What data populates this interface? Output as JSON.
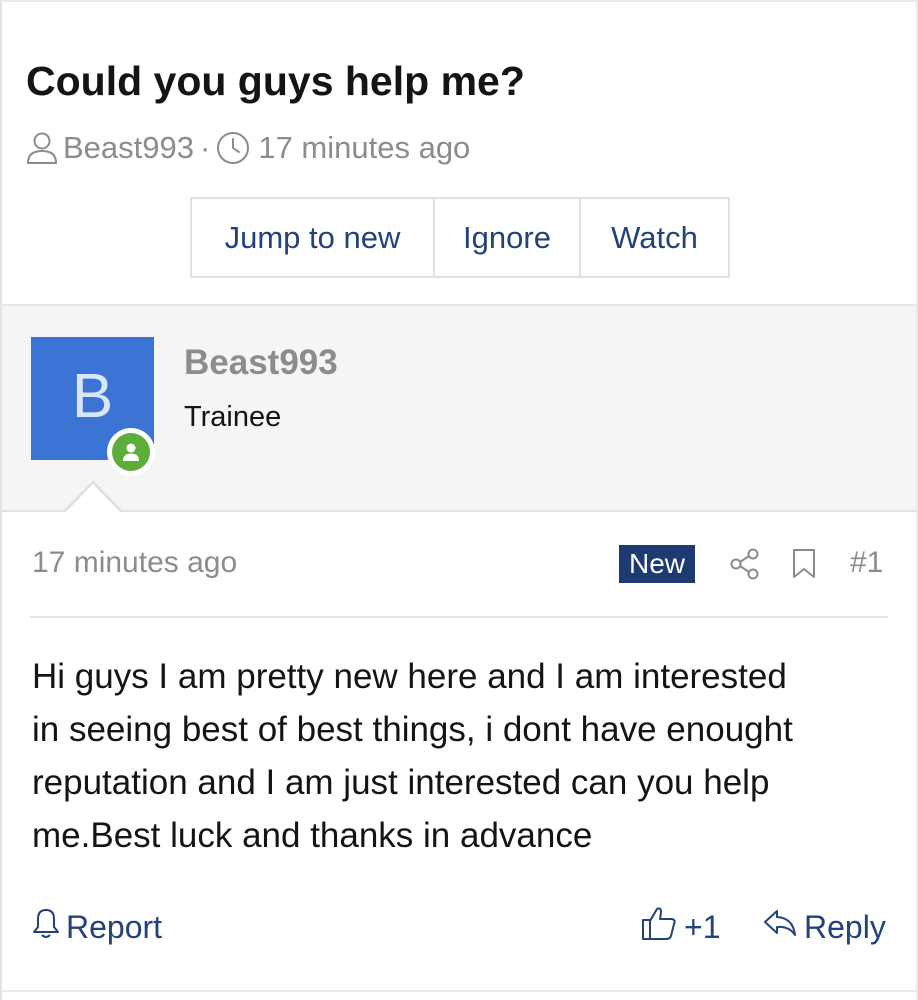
{
  "thread": {
    "title": "Could you guys help me?",
    "author": "Beast993",
    "separator": "·",
    "time_ago": "17 minutes ago",
    "actions": {
      "jump_to_new": "Jump to new",
      "ignore": "Ignore",
      "watch": "Watch"
    }
  },
  "post": {
    "avatar_letter": "B",
    "username": "Beast993",
    "user_title": "Trainee",
    "time_ago": "17 minutes ago",
    "badge": "New",
    "post_number": "#1",
    "body_lines": [
      "Hi guys I am pretty new here and I am interested",
      "in seeing best of best things, i dont have enought",
      "reputation and I am just interested can you help",
      "me.Best luck and thanks in advance"
    ],
    "footer": {
      "report": "Report",
      "like": "+1",
      "reply": "Reply"
    }
  },
  "icons": [
    "user-icon",
    "clock-icon",
    "online-status-icon",
    "share-icon",
    "bookmark-icon",
    "bell-icon",
    "thumbs-up-icon",
    "reply-icon"
  ],
  "colors": {
    "link": "#23427a",
    "muted": "#8c8c8c",
    "avatar_bg": "#3b74d4",
    "badge_bg": "#1d3a73",
    "online": "#5dad3a"
  }
}
